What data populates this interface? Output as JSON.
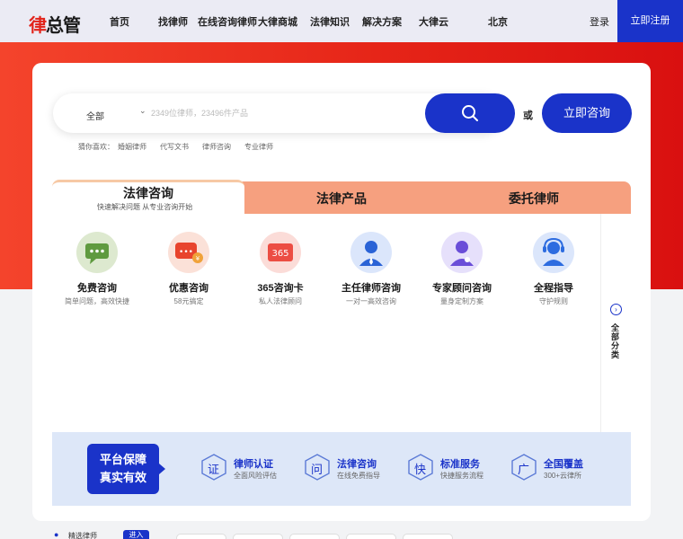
{
  "header": {
    "logo_text": "律总管",
    "nav": [
      "首页",
      "找律师",
      "在线咨询律师",
      "大律商城",
      "法律知识",
      "解决方案",
      "大律云",
      "北京"
    ],
    "login": "登录",
    "register": "立即注册"
  },
  "search": {
    "scope": "全部",
    "placeholder": "2349位律师，23496件产品",
    "or": "或",
    "consult_button": "立即咨询",
    "hot_label": "猜你喜欢：",
    "hot_items": [
      "婚姻律师",
      "代写文书",
      "律师咨询",
      "专业律师"
    ]
  },
  "tabs": [
    {
      "label": "法律咨询",
      "sub": "快速解决问题 从专业咨询开始"
    },
    {
      "label": "法律产品"
    },
    {
      "label": "委托律师"
    }
  ],
  "services": [
    {
      "title": "免费咨询",
      "sub": "简单问题，高效快捷",
      "icon": "chat-bubble-icon",
      "color": "#5f9a3f"
    },
    {
      "title": "优惠咨询",
      "sub": "58元搞定",
      "icon": "discount-chat-icon",
      "color": "#e8442d"
    },
    {
      "title": "365咨询卡",
      "sub": "私人法律顾问",
      "icon": "card-365-icon",
      "icon_text": "365",
      "color": "#ec4d43"
    },
    {
      "title": "主任律师咨询",
      "sub": "一对一高效咨询",
      "icon": "lawyer-director-icon",
      "color": "#2a63d6"
    },
    {
      "title": "专家顾问咨询",
      "sub": "量身定制方案",
      "icon": "expert-advisor-icon",
      "color": "#6a4ed8"
    },
    {
      "title": "全程指导",
      "sub": "守护规则",
      "icon": "headset-support-icon",
      "color": "#2d6ce0"
    }
  ],
  "side": {
    "label": "全部分类"
  },
  "guarantee": {
    "badge": "平台保障 真实有效",
    "items": [
      {
        "glyph": "证",
        "title": "律师认证",
        "sub": "全面风险评估"
      },
      {
        "glyph": "问",
        "title": "法律咨询",
        "sub": "在线免费指导"
      },
      {
        "glyph": "快",
        "title": "标准服务",
        "sub": "快捷服务流程"
      },
      {
        "glyph": "广",
        "title": "全国覆盖",
        "sub": "300+云律所"
      }
    ]
  },
  "bottom": {
    "label": "精选律师",
    "button": "进入"
  },
  "colors": {
    "brand_blue": "#1a33c9",
    "banner_red": "#e62518",
    "tab_orange": "#f6a07f",
    "guarantee_bg": "#dde7f8"
  }
}
